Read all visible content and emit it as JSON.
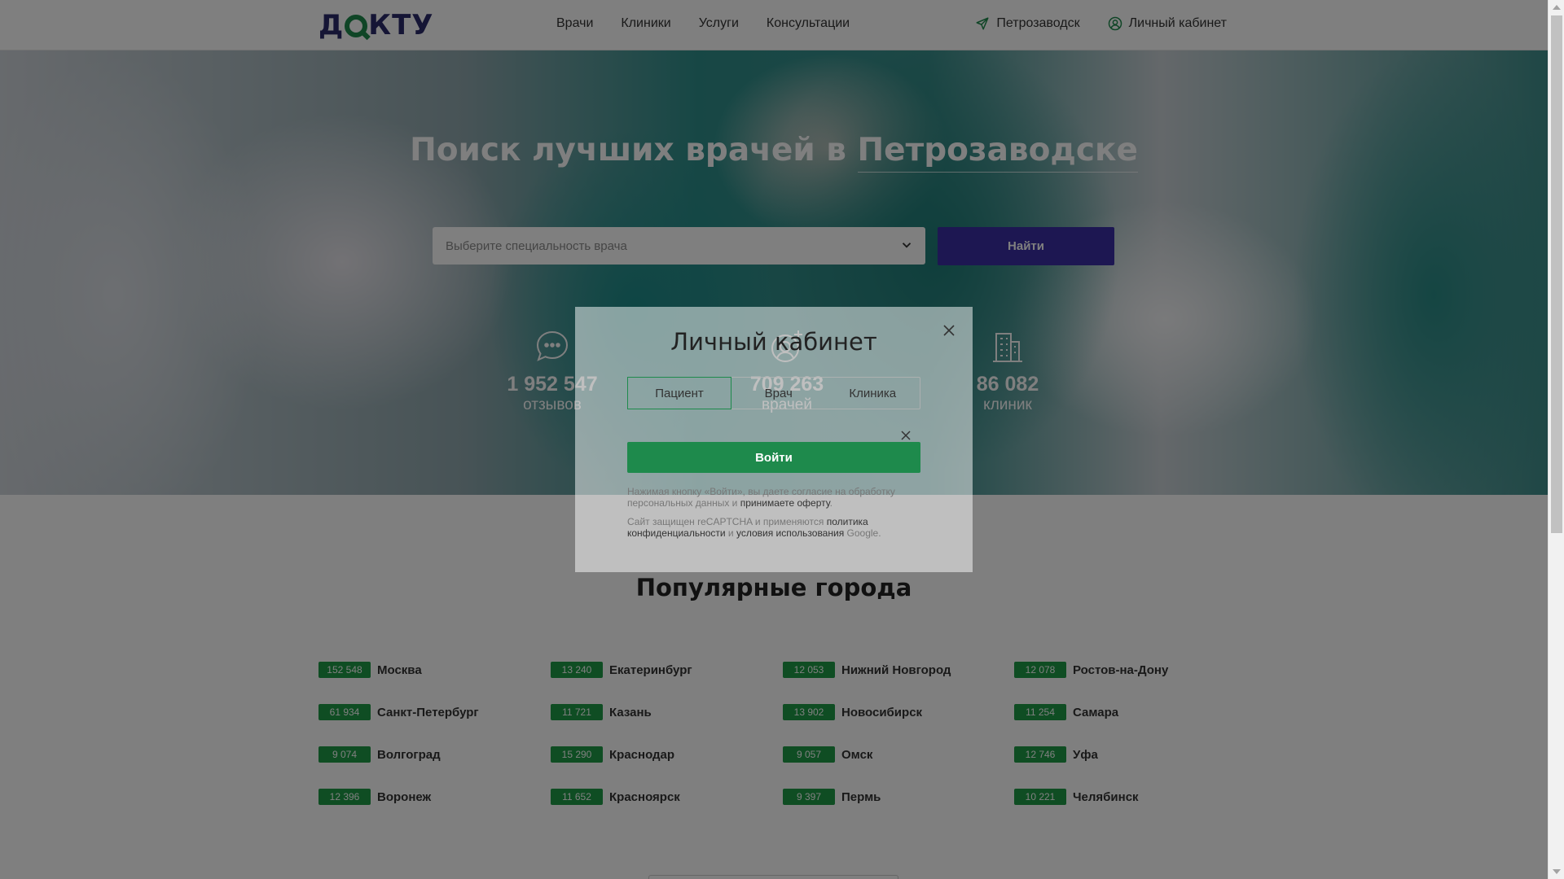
{
  "header": {
    "logo_text": "ДОКТУ",
    "nav": [
      "Врачи",
      "Клиники",
      "Услуги",
      "Консультации"
    ],
    "city": "Петрозаводск",
    "cabinet": "Личный кабинет"
  },
  "hero": {
    "title_prefix": "Поиск лучших врачей в ",
    "title_city": "Петрозаводске",
    "select_placeholder": "Выберите специальность врача",
    "search_button": "Найти",
    "stats": [
      {
        "icon": "chat-bubble-icon",
        "value": "1 952 547",
        "label": "отзывов"
      },
      {
        "icon": "doctor-plus-icon",
        "value": "709 263",
        "label": "врачей"
      },
      {
        "icon": "buildings-icon",
        "value": "86 082",
        "label": "клиник"
      }
    ]
  },
  "cities": {
    "title": "Популярные города",
    "items": [
      {
        "count": "152 548",
        "name": "Москва"
      },
      {
        "count": "13 240",
        "name": "Екатеринбург"
      },
      {
        "count": "12 053",
        "name": "Нижний Новгород"
      },
      {
        "count": "12 078",
        "name": "Ростов-на-Дону"
      },
      {
        "count": "61 934",
        "name": "Санкт-Петербург"
      },
      {
        "count": "11 721",
        "name": "Казань"
      },
      {
        "count": "13 902",
        "name": "Новосибирск"
      },
      {
        "count": "11 254",
        "name": "Самара"
      },
      {
        "count": "9 074",
        "name": "Волгоград"
      },
      {
        "count": "15 290",
        "name": "Краснодар"
      },
      {
        "count": "9 057",
        "name": "Омск"
      },
      {
        "count": "12 746",
        "name": "Уфа"
      },
      {
        "count": "12 396",
        "name": "Воронеж"
      },
      {
        "count": "11 652",
        "name": "Красноярск"
      },
      {
        "count": "9 397",
        "name": "Пермь"
      },
      {
        "count": "10 221",
        "name": "Челябинск"
      }
    ]
  },
  "modal": {
    "title": "Личный кабинет",
    "tabs": [
      "Пациент",
      "Врач",
      "Клиника"
    ],
    "login_button": "Войти",
    "consent_text_1": "Нажимая кнопку «Войти», вы даете согласие на обработку персональных данных и ",
    "consent_link": "принимаете оферту",
    "consent_text_2": ".",
    "recaptcha_text_1": "Сайт защищен reCAPTCHA и применяются ",
    "recaptcha_link_1": "политика конфиденциальности",
    "recaptcha_text_2": " и ",
    "recaptcha_link_2": "условия использования",
    "recaptcha_text_3": " Google."
  },
  "colors": {
    "brand_green": "#1e8a4c",
    "brand_purple": "#3a2fa4",
    "badge_green": "#1e9a47"
  }
}
